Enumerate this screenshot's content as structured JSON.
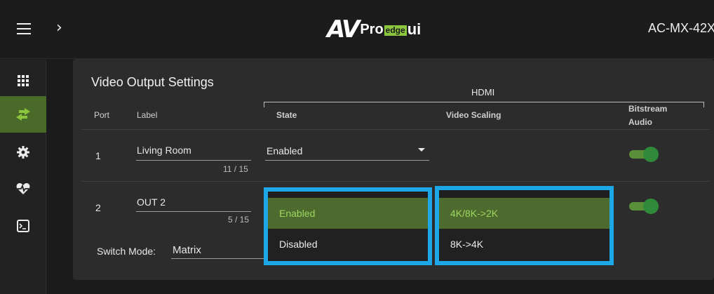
{
  "header": {
    "logo": {
      "av": "AV",
      "pro": "Pro",
      "edge": "edge",
      "ui": "ui"
    },
    "model": "AC-MX-42X"
  },
  "sidebar": {
    "items": [
      {
        "name": "dashboard",
        "icon": "grid-icon",
        "active": false
      },
      {
        "name": "routing",
        "icon": "swap-arrows-icon",
        "active": true
      },
      {
        "name": "settings",
        "icon": "gear-icon",
        "active": false
      },
      {
        "name": "health",
        "icon": "heartbeat-icon",
        "active": false
      },
      {
        "name": "terminal",
        "icon": "terminal-icon",
        "active": false
      }
    ]
  },
  "panel": {
    "title": "Video Output Settings",
    "group_label": "HDMI",
    "columns": {
      "port": "Port",
      "label": "Label",
      "state": "State",
      "video_scaling": "Video Scaling",
      "bitstream_audio_line1": "Bitstream",
      "bitstream_audio_line2": "Audio"
    },
    "rows": [
      {
        "port": "1",
        "label": "Living Room",
        "counter": "11 / 15",
        "state": "Enabled",
        "bitstream_on": true
      },
      {
        "port": "2",
        "label": "OUT 2",
        "counter": "5 / 15",
        "state": "Enabled",
        "bitstream_on": true
      }
    ],
    "switch_mode": {
      "label": "Switch Mode:",
      "value": "Matrix"
    }
  },
  "dropdowns": {
    "state_options": [
      "Enabled",
      "Disabled"
    ],
    "scaling_options": [
      "4K/8K->2K",
      "8K->4K"
    ]
  },
  "colors": {
    "accent_green": "#8cc63f",
    "highlight_blue": "#1ea7e6",
    "active_sidebar": "#4a6a2a"
  }
}
